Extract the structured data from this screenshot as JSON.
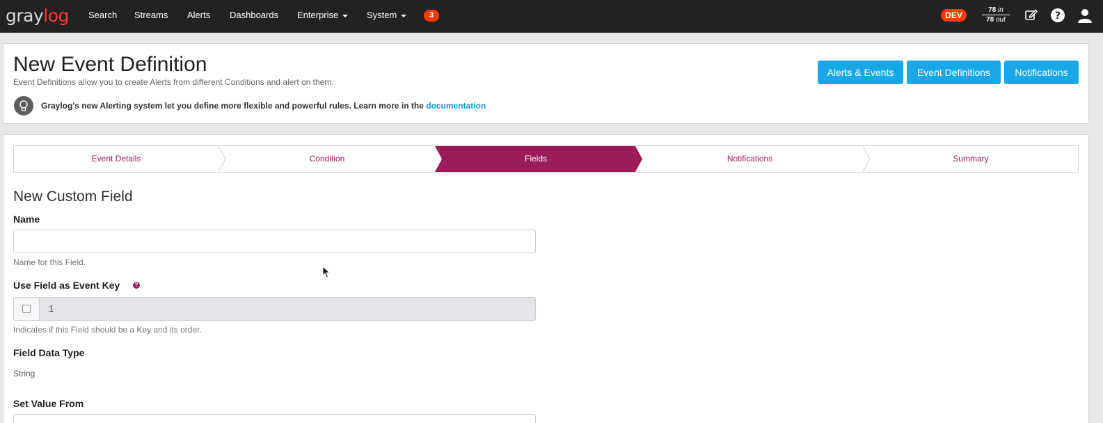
{
  "nav": {
    "logo_left": "gray",
    "logo_right": "log",
    "items": [
      {
        "label": "Search"
      },
      {
        "label": "Streams"
      },
      {
        "label": "Alerts"
      },
      {
        "label": "Dashboards"
      },
      {
        "label": "Enterprise"
      },
      {
        "label": "System"
      }
    ],
    "notification_count": "3",
    "env_badge": "DEV",
    "throughput": {
      "in_value": "78",
      "in_label": "in",
      "out_value": "78",
      "out_label": "out"
    },
    "icons": [
      "edit-icon",
      "help-icon",
      "user-icon"
    ]
  },
  "header": {
    "title": "New Event Definition",
    "description": "Event Definitions allow you to create Alerts from different Conditions and alert on them.",
    "tip_text": "Graylog's new Alerting system let you define more flexible and powerful rules. Learn more in the",
    "tip_link": "documentation",
    "buttons": [
      {
        "label": "Alerts & Events"
      },
      {
        "label": "Event Definitions"
      },
      {
        "label": "Notifications"
      }
    ]
  },
  "wizard": {
    "steps": [
      {
        "label": "Event Details",
        "active": false
      },
      {
        "label": "Condition",
        "active": false
      },
      {
        "label": "Fields",
        "active": true
      },
      {
        "label": "Notifications",
        "active": false
      },
      {
        "label": "Summary",
        "active": false
      }
    ]
  },
  "form": {
    "section_title": "New Custom Field",
    "name_label": "Name",
    "name_value": "",
    "name_help": "Name for this Field.",
    "event_key_label": "Use Field as Event Key",
    "event_key_checked": false,
    "event_key_order": "1",
    "event_key_help": "Indicates if this Field should be a Key and its order.",
    "data_type_label": "Field Data Type",
    "data_type_value": "String",
    "set_value_label": "Set Value From"
  },
  "colors": {
    "navbar": "#222222",
    "accent_magenta": "#9c1b59",
    "primary_blue": "#1aa7e8",
    "badge_red": "#ff3b00"
  }
}
